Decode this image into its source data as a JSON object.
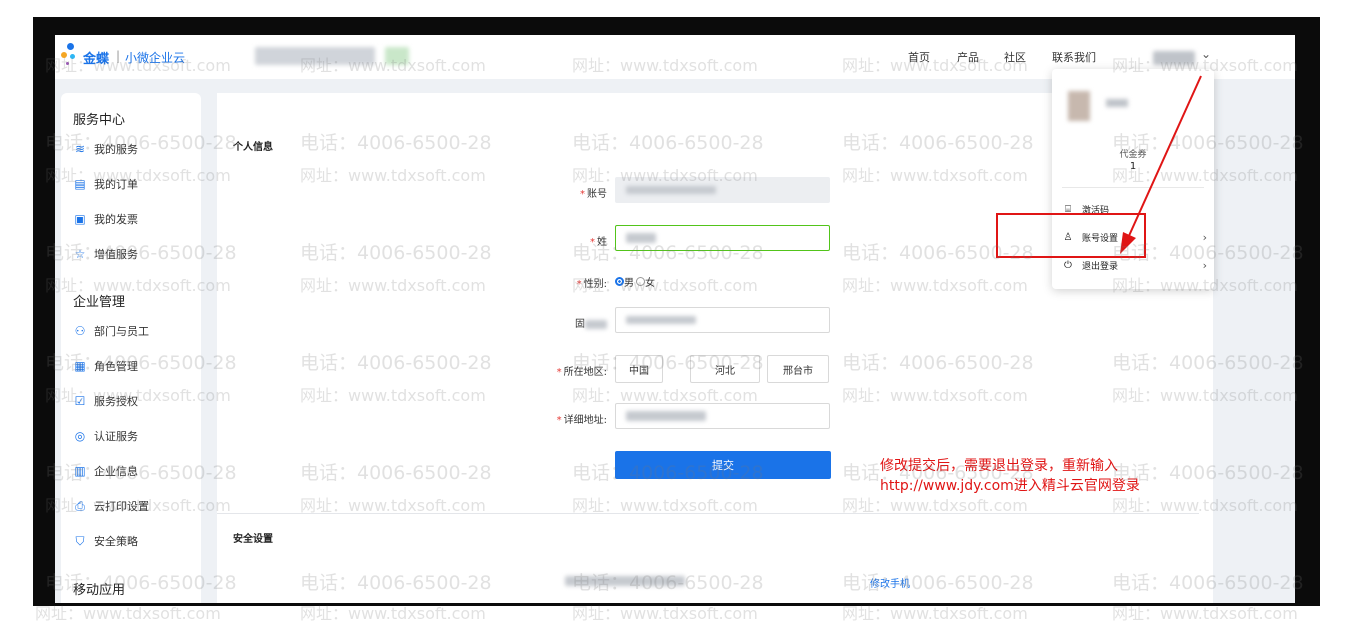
{
  "brand": {
    "name": "金蝶",
    "separator": "|",
    "subtitle": "小微企业云"
  },
  "nav": {
    "home": "首页",
    "products": "产品",
    "community": "社区",
    "contact": "联系我们"
  },
  "sidebar": {
    "service_center": "服务中心",
    "service_items": [
      {
        "label": "我的服务",
        "icon": "layers-icon"
      },
      {
        "label": "我的订单",
        "icon": "order-icon"
      },
      {
        "label": "我的发票",
        "icon": "invoice-icon"
      },
      {
        "label": "增值服务",
        "icon": "star-icon"
      }
    ],
    "enterprise_mgmt": "企业管理",
    "enterprise_items": [
      {
        "label": "部门与员工",
        "icon": "people-icon"
      },
      {
        "label": "角色管理",
        "icon": "role-icon"
      },
      {
        "label": "服务授权",
        "icon": "check-square-icon"
      },
      {
        "label": "认证服务",
        "icon": "target-icon"
      },
      {
        "label": "企业信息",
        "icon": "building-icon"
      },
      {
        "label": "云打印设置",
        "icon": "printer-icon"
      },
      {
        "label": "安全策略",
        "icon": "shield-icon"
      }
    ],
    "mobile_apps": "移动应用"
  },
  "profile": {
    "section_title": "个人信息",
    "account_label": "账号",
    "name_label": "姓",
    "gender_label": "性别:",
    "gender_male": "男",
    "gender_female": "女",
    "phone_label": "固",
    "region_label": "所在地区:",
    "region_country": "中国",
    "region_province": "河北",
    "region_city": "邢台市",
    "address_label": "详细地址:",
    "submit": "提交"
  },
  "security": {
    "section_title": "安全设置",
    "change_phone": "修改手机"
  },
  "dropdown": {
    "voucher_label": "代金券",
    "voucher_count": "1",
    "activation_code": "激活码",
    "account_settings": "账号设置",
    "logout": "退出登录"
  },
  "annotation": {
    "line1": "修改提交后，需要退出登录，重新输入",
    "line2": "http://www.jdy.com进入精斗云官网登录"
  },
  "watermark": {
    "phone": "电话：4006-6500-28",
    "site": "网址：www.tdxsoft.com"
  },
  "colors": {
    "accent": "#1a73e8",
    "annotation": "#e01515",
    "success_border": "#52c41a"
  }
}
